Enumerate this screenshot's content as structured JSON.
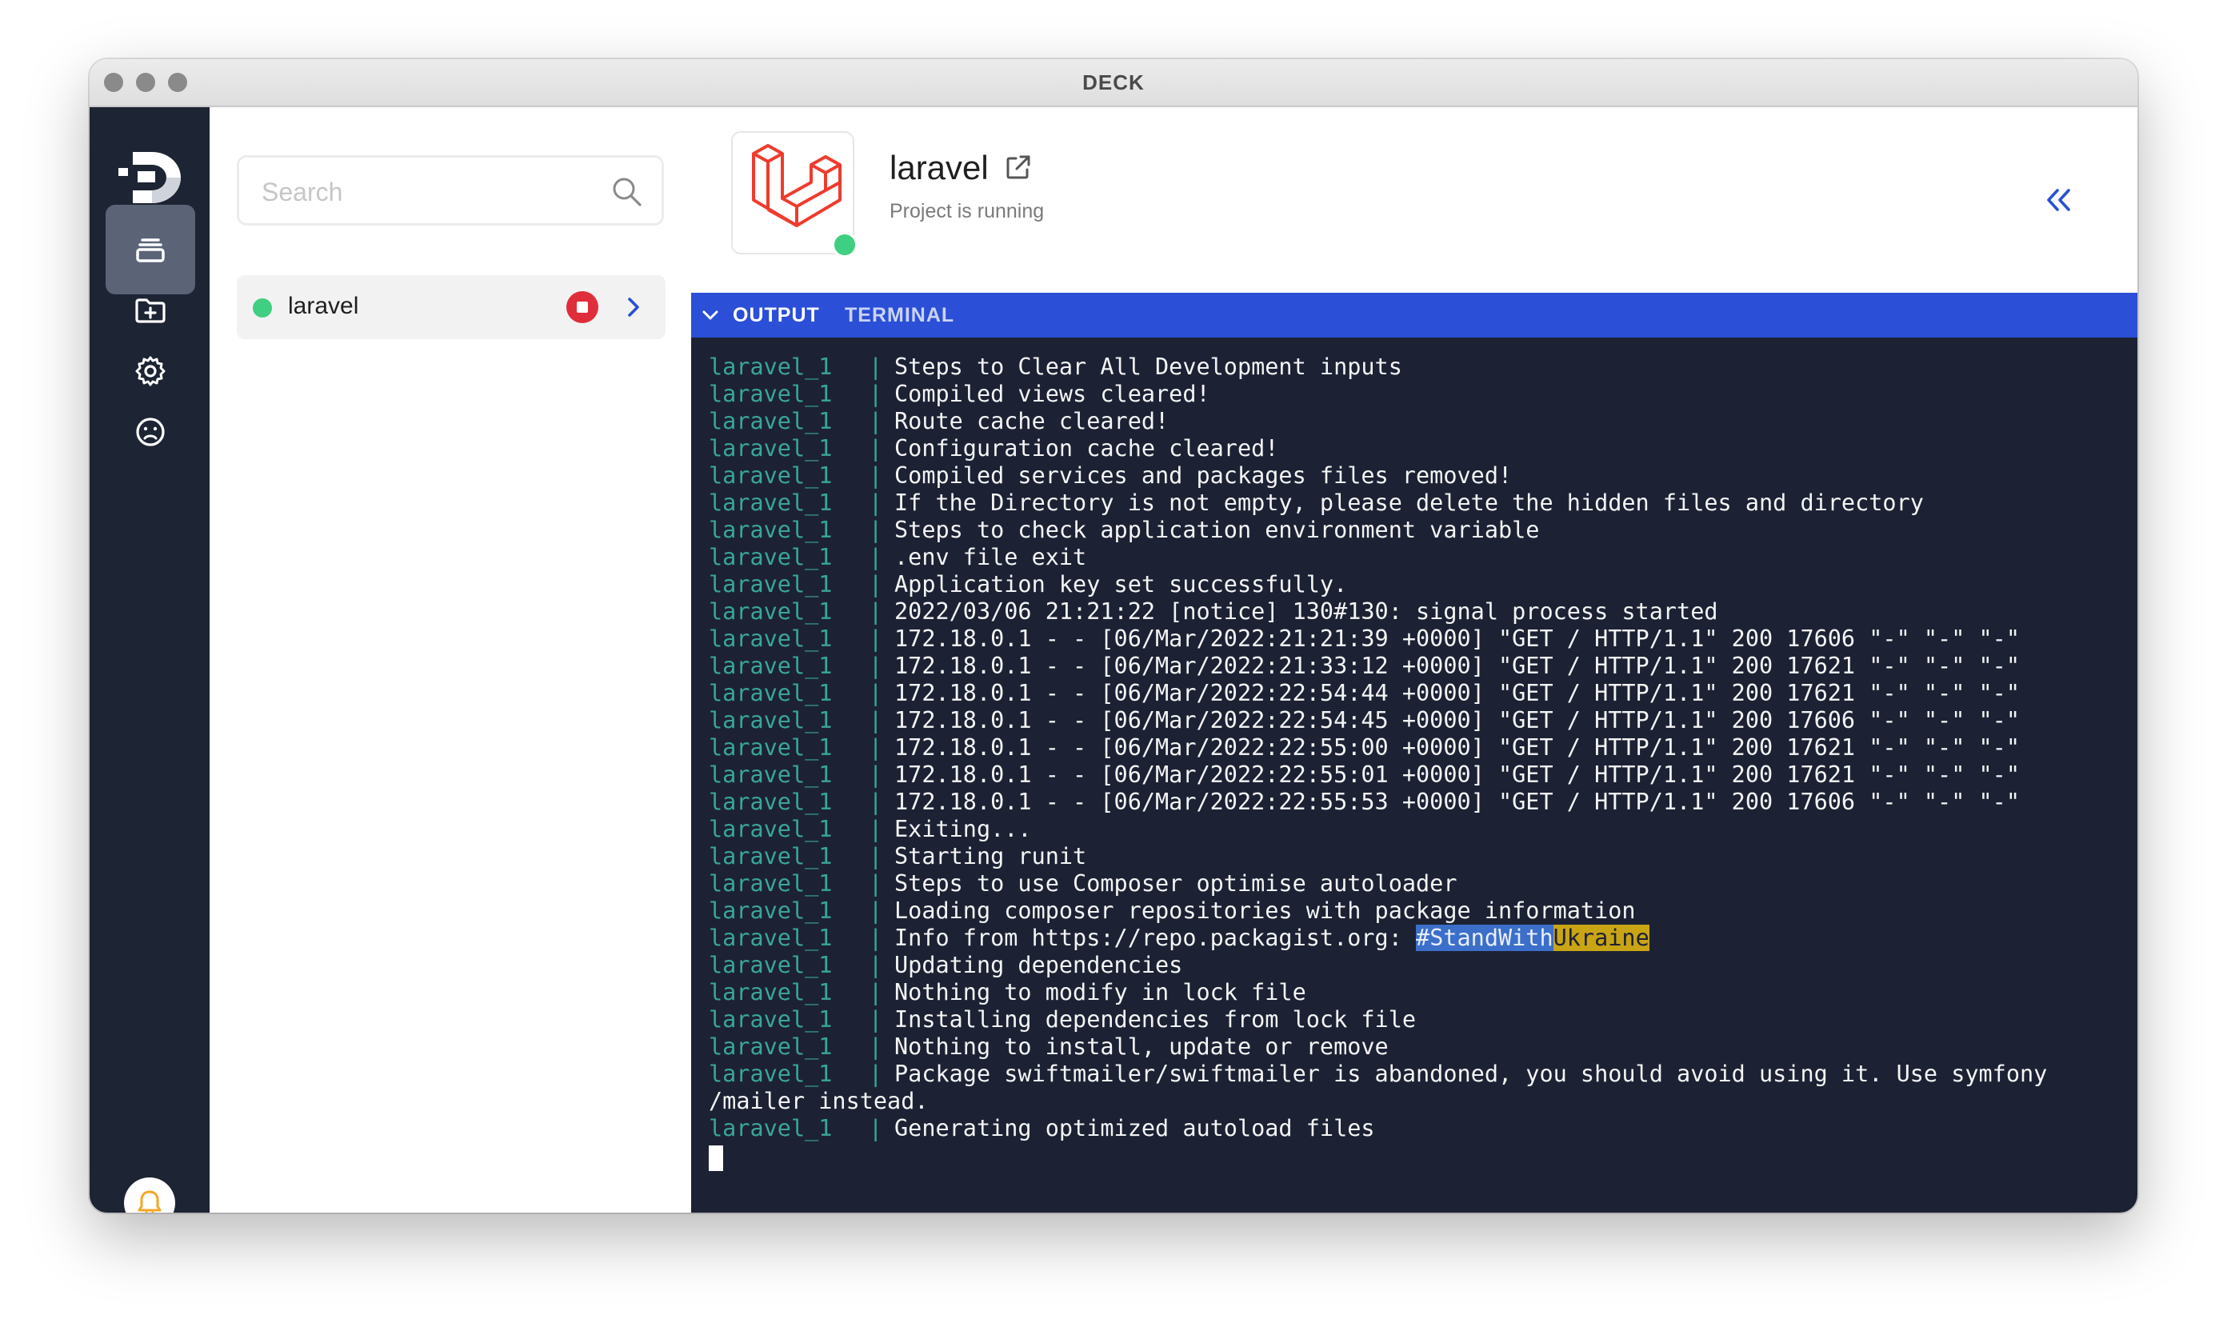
{
  "window": {
    "title": "DECK"
  },
  "rail": {
    "icons": [
      "deck-logo",
      "projects-icon",
      "add-folder-icon",
      "settings-icon",
      "sad-face-icon",
      "bell-icon"
    ],
    "accent": "#f5a623"
  },
  "search": {
    "placeholder": "Search",
    "value": ""
  },
  "projects": [
    {
      "name": "laravel",
      "status": "running",
      "status_color": "#3fcf82"
    }
  ],
  "header": {
    "project_name": "laravel",
    "status_text": "Project is running"
  },
  "tabs": {
    "output": "OUTPUT",
    "terminal": "TERMINAL",
    "active": "OUTPUT"
  },
  "colors": {
    "tabbar": "#2b4fd6",
    "terminal_bg": "#1c2234",
    "service_prefix": "#3aa59a",
    "rail": "#1d2433"
  },
  "terminal": {
    "lines": [
      {
        "service": "laravel_1",
        "text": "Steps to Clear All Development inputs"
      },
      {
        "service": "laravel_1",
        "text": "Compiled views cleared!"
      },
      {
        "service": "laravel_1",
        "text": "Route cache cleared!"
      },
      {
        "service": "laravel_1",
        "text": "Configuration cache cleared!"
      },
      {
        "service": "laravel_1",
        "text": "Compiled services and packages files removed!"
      },
      {
        "service": "laravel_1",
        "text": "If the Directory is not empty, please delete the hidden files and directory"
      },
      {
        "service": "laravel_1",
        "text": "Steps to check application environment variable"
      },
      {
        "service": "laravel_1",
        "text": ".env file exit"
      },
      {
        "service": "laravel_1",
        "text": "Application key set successfully."
      },
      {
        "service": "laravel_1",
        "text": "2022/03/06 21:21:22 [notice] 130#130: signal process started"
      },
      {
        "service": "laravel_1",
        "text": "172.18.0.1 - - [06/Mar/2022:21:21:39 +0000] \"GET / HTTP/1.1\" 200 17606 \"-\" \"-\" \"-\""
      },
      {
        "service": "laravel_1",
        "text": "172.18.0.1 - - [06/Mar/2022:21:33:12 +0000] \"GET / HTTP/1.1\" 200 17621 \"-\" \"-\" \"-\""
      },
      {
        "service": "laravel_1",
        "text": "172.18.0.1 - - [06/Mar/2022:22:54:44 +0000] \"GET / HTTP/1.1\" 200 17621 \"-\" \"-\" \"-\""
      },
      {
        "service": "laravel_1",
        "text": "172.18.0.1 - - [06/Mar/2022:22:54:45 +0000] \"GET / HTTP/1.1\" 200 17606 \"-\" \"-\" \"-\""
      },
      {
        "service": "laravel_1",
        "text": "172.18.0.1 - - [06/Mar/2022:22:55:00 +0000] \"GET / HTTP/1.1\" 200 17621 \"-\" \"-\" \"-\""
      },
      {
        "service": "laravel_1",
        "text": "172.18.0.1 - - [06/Mar/2022:22:55:01 +0000] \"GET / HTTP/1.1\" 200 17621 \"-\" \"-\" \"-\""
      },
      {
        "service": "laravel_1",
        "text": "172.18.0.1 - - [06/Mar/2022:22:55:53 +0000] \"GET / HTTP/1.1\" 200 17606 \"-\" \"-\" \"-\""
      },
      {
        "service": "laravel_1",
        "text": "Exiting..."
      },
      {
        "service": "laravel_1",
        "text": "Starting runit"
      },
      {
        "service": "laravel_1",
        "text": "Steps to use Composer optimise autoloader"
      },
      {
        "service": "laravel_1",
        "text": "Loading composer repositories with package information"
      },
      {
        "service": "laravel_1",
        "text": "Info from https://repo.packagist.org: ",
        "highlight_blue": "#StandWith",
        "highlight_yellow": "Ukraine"
      },
      {
        "service": "laravel_1",
        "text": "Updating dependencies"
      },
      {
        "service": "laravel_1",
        "text": "Nothing to modify in lock file"
      },
      {
        "service": "laravel_1",
        "text": "Installing dependencies from lock file"
      },
      {
        "service": "laravel_1",
        "text": "Nothing to install, update or remove"
      },
      {
        "service": "laravel_1",
        "text": "Package swiftmailer/swiftmailer is abandoned, you should avoid using it. Use symfony"
      },
      {
        "service": "",
        "text": "/mailer instead."
      },
      {
        "service": "laravel_1",
        "text": "Generating optimized autoload files"
      }
    ]
  }
}
